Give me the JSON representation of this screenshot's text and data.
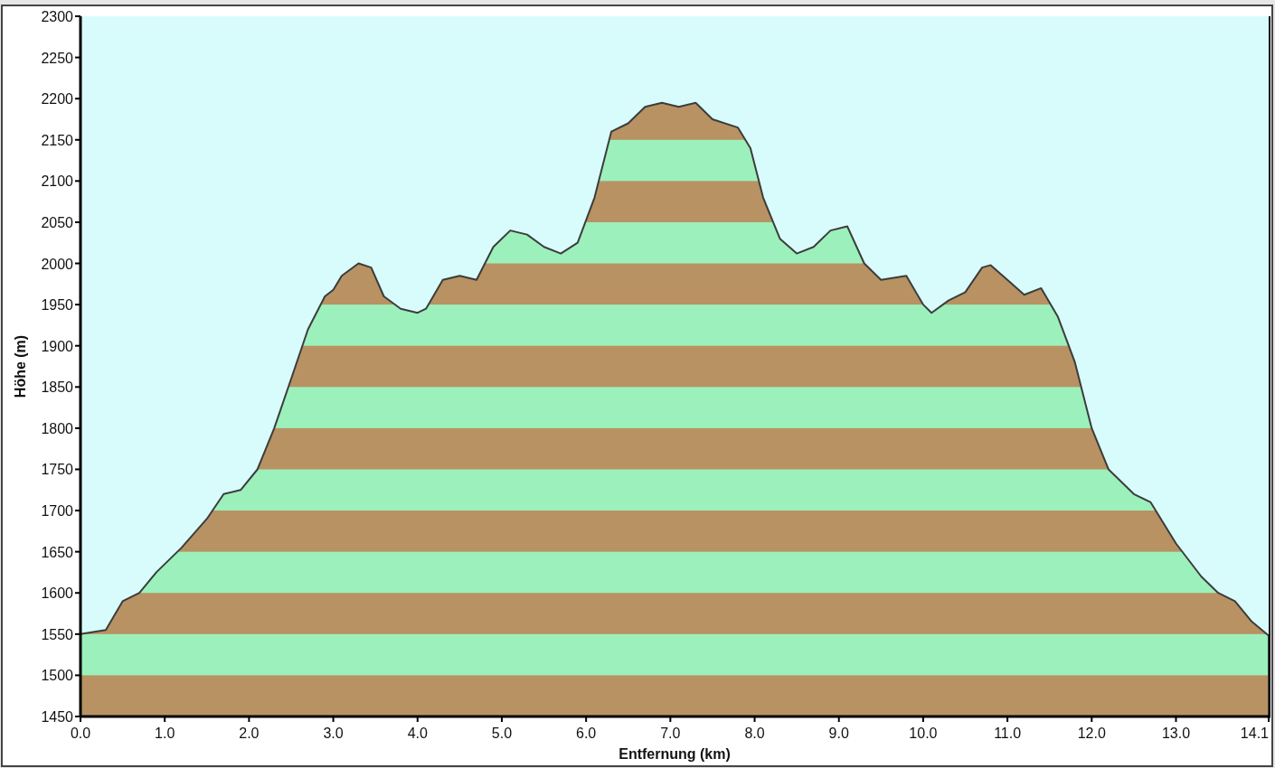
{
  "chart_data": {
    "type": "area",
    "xlabel": "Entfernung (km)",
    "ylabel": "Höhe (m)",
    "xlim": [
      0,
      14.1
    ],
    "ylim": [
      1450,
      2300
    ],
    "xticks": [
      {
        "value": 0,
        "label": "0.0"
      },
      {
        "value": 1,
        "label": "1.0"
      },
      {
        "value": 2,
        "label": "2.0"
      },
      {
        "value": 3,
        "label": "3.0"
      },
      {
        "value": 4,
        "label": "4.0"
      },
      {
        "value": 5,
        "label": "5.0"
      },
      {
        "value": 6,
        "label": "6.0"
      },
      {
        "value": 7,
        "label": "7.0"
      },
      {
        "value": 8,
        "label": "8.0"
      },
      {
        "value": 9,
        "label": "9.0"
      },
      {
        "value": 10,
        "label": "10.0"
      },
      {
        "value": 11,
        "label": "11.0"
      },
      {
        "value": 12,
        "label": "12.0"
      },
      {
        "value": 13,
        "label": "13.0"
      },
      {
        "value": 14.1,
        "label": "14.1"
      }
    ],
    "yticks": [
      1450,
      1500,
      1550,
      1600,
      1650,
      1700,
      1750,
      1800,
      1850,
      1900,
      1950,
      2000,
      2050,
      2100,
      2150,
      2200,
      2250,
      2300
    ],
    "x": [
      0,
      0.3,
      0.5,
      0.7,
      0.9,
      1.2,
      1.5,
      1.7,
      1.9,
      2.1,
      2.3,
      2.5,
      2.7,
      2.9,
      3.0,
      3.1,
      3.3,
      3.45,
      3.6,
      3.8,
      4.0,
      4.1,
      4.3,
      4.5,
      4.7,
      4.9,
      5.1,
      5.3,
      5.5,
      5.7,
      5.9,
      6.1,
      6.3,
      6.5,
      6.7,
      6.9,
      7.1,
      7.3,
      7.5,
      7.8,
      7.95,
      8.1,
      8.3,
      8.5,
      8.7,
      8.9,
      9.1,
      9.3,
      9.5,
      9.8,
      10.0,
      10.1,
      10.3,
      10.5,
      10.7,
      10.8,
      11.0,
      11.2,
      11.4,
      11.6,
      11.8,
      12.0,
      12.2,
      12.5,
      12.7,
      13.0,
      13.3,
      13.5,
      13.7,
      13.9,
      14.1
    ],
    "values": [
      1550,
      1555,
      1590,
      1600,
      1625,
      1655,
      1690,
      1720,
      1725,
      1750,
      1800,
      1860,
      1920,
      1960,
      1968,
      1985,
      2000,
      1995,
      1960,
      1945,
      1940,
      1945,
      1980,
      1985,
      1980,
      2020,
      2040,
      2035,
      2020,
      2012,
      2025,
      2080,
      2160,
      2170,
      2190,
      2195,
      2190,
      2195,
      2175,
      2165,
      2140,
      2080,
      2030,
      2012,
      2020,
      2040,
      2045,
      2000,
      1980,
      1985,
      1950,
      1940,
      1955,
      1965,
      1995,
      1998,
      1980,
      1962,
      1970,
      1935,
      1880,
      1800,
      1750,
      1720,
      1710,
      1660,
      1620,
      1600,
      1590,
      1565,
      1548
    ]
  }
}
